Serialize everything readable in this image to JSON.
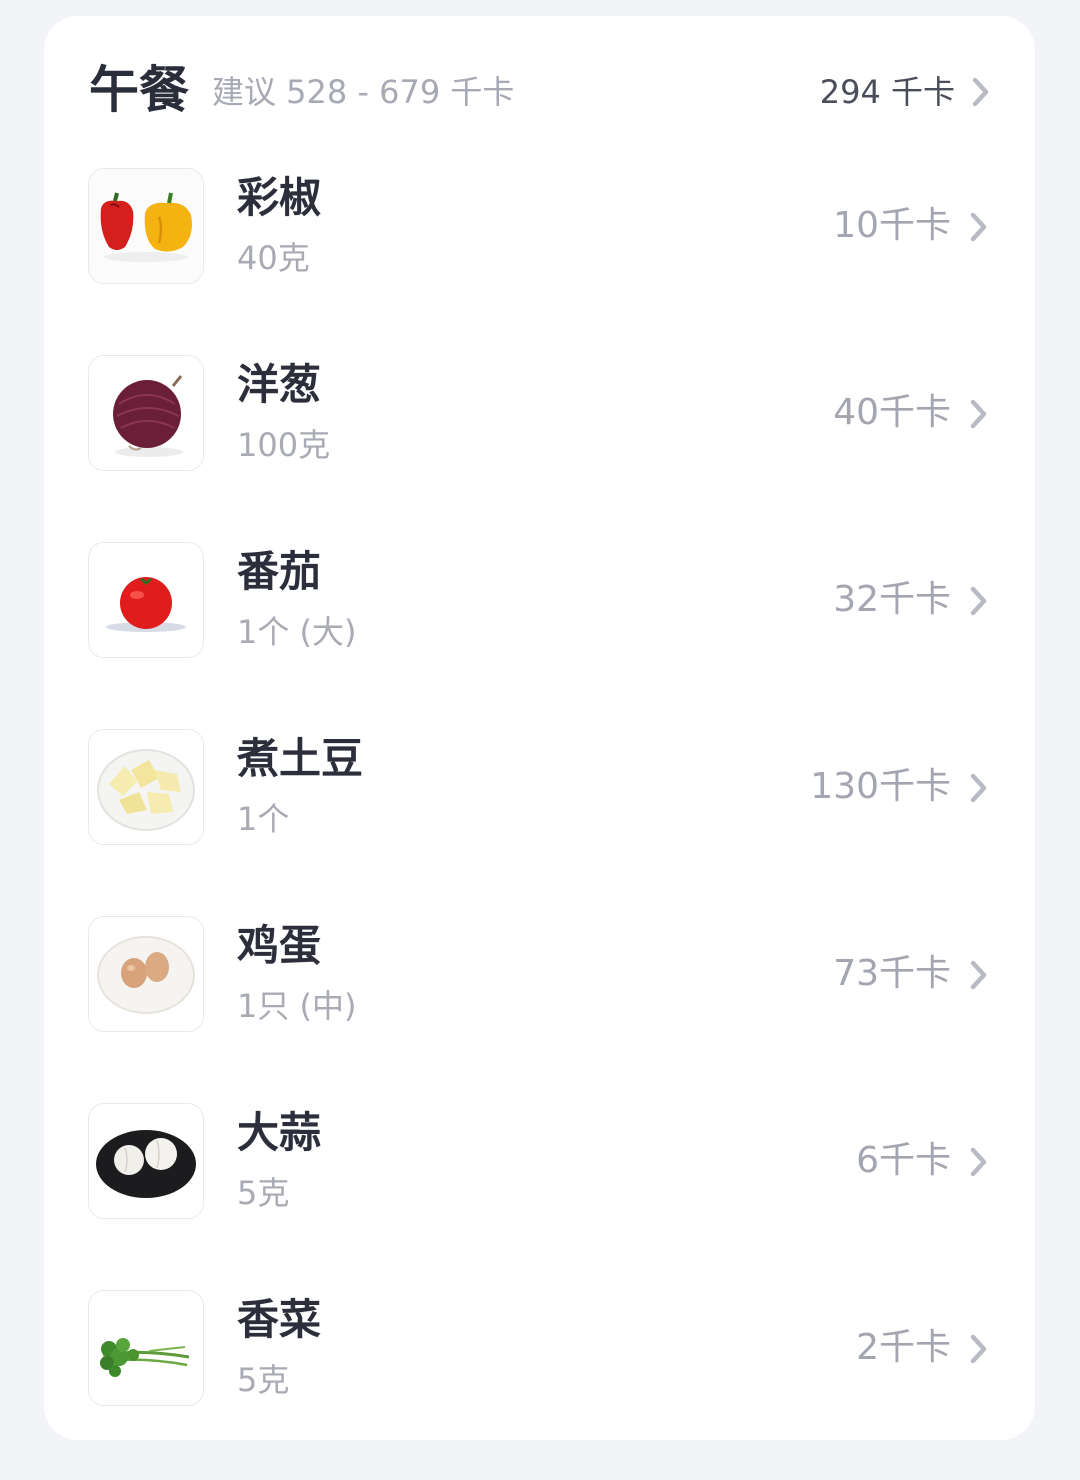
{
  "meal": {
    "title": "午餐",
    "suggestion": "建议 528 - 679 千卡",
    "total": "294 千卡"
  },
  "foods": [
    {
      "name": "彩椒",
      "amount": "40克",
      "kcal": "10千卡",
      "icon": "bell-pepper-image"
    },
    {
      "name": "洋葱",
      "amount": "100克",
      "kcal": "40千卡",
      "icon": "onion-image"
    },
    {
      "name": "番茄",
      "amount": "1个 (大)",
      "kcal": "32千卡",
      "icon": "tomato-image"
    },
    {
      "name": "煮土豆",
      "amount": "1个",
      "kcal": "130千卡",
      "icon": "boiled-potato-image"
    },
    {
      "name": "鸡蛋",
      "amount": "1只 (中)",
      "kcal": "73千卡",
      "icon": "egg-image"
    },
    {
      "name": "大蒜",
      "amount": "5克",
      "kcal": "6千卡",
      "icon": "garlic-image"
    },
    {
      "name": "香菜",
      "amount": "5克",
      "kcal": "2千卡",
      "icon": "cilantro-image"
    }
  ],
  "colors": {
    "background": "#f3f4f8",
    "card": "#ffffff",
    "title": "#2a2d3a",
    "muted": "#a7a9b4",
    "chevron": "#b9bbc4"
  }
}
